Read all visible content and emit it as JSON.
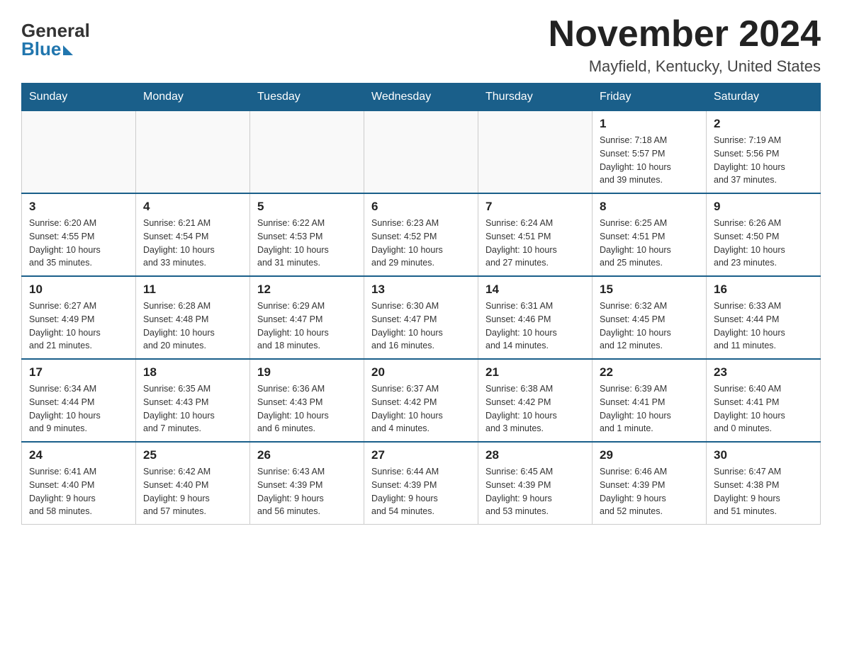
{
  "header": {
    "logo_general": "General",
    "logo_blue": "Blue",
    "month_title": "November 2024",
    "location": "Mayfield, Kentucky, United States"
  },
  "days_of_week": [
    "Sunday",
    "Monday",
    "Tuesday",
    "Wednesday",
    "Thursday",
    "Friday",
    "Saturday"
  ],
  "weeks": [
    [
      {
        "day": "",
        "info": ""
      },
      {
        "day": "",
        "info": ""
      },
      {
        "day": "",
        "info": ""
      },
      {
        "day": "",
        "info": ""
      },
      {
        "day": "",
        "info": ""
      },
      {
        "day": "1",
        "info": "Sunrise: 7:18 AM\nSunset: 5:57 PM\nDaylight: 10 hours\nand 39 minutes."
      },
      {
        "day": "2",
        "info": "Sunrise: 7:19 AM\nSunset: 5:56 PM\nDaylight: 10 hours\nand 37 minutes."
      }
    ],
    [
      {
        "day": "3",
        "info": "Sunrise: 6:20 AM\nSunset: 4:55 PM\nDaylight: 10 hours\nand 35 minutes."
      },
      {
        "day": "4",
        "info": "Sunrise: 6:21 AM\nSunset: 4:54 PM\nDaylight: 10 hours\nand 33 minutes."
      },
      {
        "day": "5",
        "info": "Sunrise: 6:22 AM\nSunset: 4:53 PM\nDaylight: 10 hours\nand 31 minutes."
      },
      {
        "day": "6",
        "info": "Sunrise: 6:23 AM\nSunset: 4:52 PM\nDaylight: 10 hours\nand 29 minutes."
      },
      {
        "day": "7",
        "info": "Sunrise: 6:24 AM\nSunset: 4:51 PM\nDaylight: 10 hours\nand 27 minutes."
      },
      {
        "day": "8",
        "info": "Sunrise: 6:25 AM\nSunset: 4:51 PM\nDaylight: 10 hours\nand 25 minutes."
      },
      {
        "day": "9",
        "info": "Sunrise: 6:26 AM\nSunset: 4:50 PM\nDaylight: 10 hours\nand 23 minutes."
      }
    ],
    [
      {
        "day": "10",
        "info": "Sunrise: 6:27 AM\nSunset: 4:49 PM\nDaylight: 10 hours\nand 21 minutes."
      },
      {
        "day": "11",
        "info": "Sunrise: 6:28 AM\nSunset: 4:48 PM\nDaylight: 10 hours\nand 20 minutes."
      },
      {
        "day": "12",
        "info": "Sunrise: 6:29 AM\nSunset: 4:47 PM\nDaylight: 10 hours\nand 18 minutes."
      },
      {
        "day": "13",
        "info": "Sunrise: 6:30 AM\nSunset: 4:47 PM\nDaylight: 10 hours\nand 16 minutes."
      },
      {
        "day": "14",
        "info": "Sunrise: 6:31 AM\nSunset: 4:46 PM\nDaylight: 10 hours\nand 14 minutes."
      },
      {
        "day": "15",
        "info": "Sunrise: 6:32 AM\nSunset: 4:45 PM\nDaylight: 10 hours\nand 12 minutes."
      },
      {
        "day": "16",
        "info": "Sunrise: 6:33 AM\nSunset: 4:44 PM\nDaylight: 10 hours\nand 11 minutes."
      }
    ],
    [
      {
        "day": "17",
        "info": "Sunrise: 6:34 AM\nSunset: 4:44 PM\nDaylight: 10 hours\nand 9 minutes."
      },
      {
        "day": "18",
        "info": "Sunrise: 6:35 AM\nSunset: 4:43 PM\nDaylight: 10 hours\nand 7 minutes."
      },
      {
        "day": "19",
        "info": "Sunrise: 6:36 AM\nSunset: 4:43 PM\nDaylight: 10 hours\nand 6 minutes."
      },
      {
        "day": "20",
        "info": "Sunrise: 6:37 AM\nSunset: 4:42 PM\nDaylight: 10 hours\nand 4 minutes."
      },
      {
        "day": "21",
        "info": "Sunrise: 6:38 AM\nSunset: 4:42 PM\nDaylight: 10 hours\nand 3 minutes."
      },
      {
        "day": "22",
        "info": "Sunrise: 6:39 AM\nSunset: 4:41 PM\nDaylight: 10 hours\nand 1 minute."
      },
      {
        "day": "23",
        "info": "Sunrise: 6:40 AM\nSunset: 4:41 PM\nDaylight: 10 hours\nand 0 minutes."
      }
    ],
    [
      {
        "day": "24",
        "info": "Sunrise: 6:41 AM\nSunset: 4:40 PM\nDaylight: 9 hours\nand 58 minutes."
      },
      {
        "day": "25",
        "info": "Sunrise: 6:42 AM\nSunset: 4:40 PM\nDaylight: 9 hours\nand 57 minutes."
      },
      {
        "day": "26",
        "info": "Sunrise: 6:43 AM\nSunset: 4:39 PM\nDaylight: 9 hours\nand 56 minutes."
      },
      {
        "day": "27",
        "info": "Sunrise: 6:44 AM\nSunset: 4:39 PM\nDaylight: 9 hours\nand 54 minutes."
      },
      {
        "day": "28",
        "info": "Sunrise: 6:45 AM\nSunset: 4:39 PM\nDaylight: 9 hours\nand 53 minutes."
      },
      {
        "day": "29",
        "info": "Sunrise: 6:46 AM\nSunset: 4:39 PM\nDaylight: 9 hours\nand 52 minutes."
      },
      {
        "day": "30",
        "info": "Sunrise: 6:47 AM\nSunset: 4:38 PM\nDaylight: 9 hours\nand 51 minutes."
      }
    ]
  ]
}
